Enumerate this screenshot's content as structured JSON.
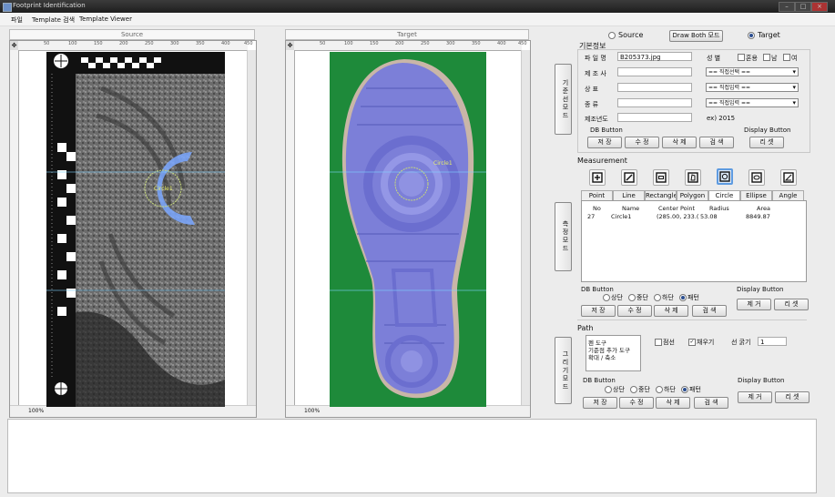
{
  "window": {
    "title": "Footprint Identification"
  },
  "menu": [
    "파일",
    "Template 검색",
    "Template Viewer"
  ],
  "source_panel": {
    "header": "Source",
    "zoom": "100%",
    "canvas_label": "Circle1"
  },
  "target_panel": {
    "header": "Target",
    "zoom": "100%",
    "canvas_label": "Circle1"
  },
  "ruler_ticks": [
    "50",
    "100",
    "150",
    "200",
    "250",
    "300",
    "350",
    "400",
    "450"
  ],
  "mode": {
    "source_label": "Source",
    "draw_both_label": "Draw Both 모드",
    "target_label": "Target",
    "selected": "Target"
  },
  "basic_info": {
    "title": "기본정보",
    "mode_button": "기준선모드",
    "filename_label": "파 일 명",
    "filename_value": "B205373.jpg",
    "maker_label": "제 조 사",
    "label_label": "상 표",
    "type_label": "종 류",
    "year_label": "제조년도",
    "year_hint": "ex) 2015",
    "gender_label": "성 별",
    "gender_options": [
      "혼용",
      "남",
      "여"
    ],
    "select1": "== 직접선택 ==",
    "select2": "== 직접입력 ==",
    "select3": "== 직접입력 =="
  },
  "db_button1": {
    "title": "DB Button",
    "save": "저 장",
    "edit": "수 정",
    "delete": "삭 제",
    "search": "검 색"
  },
  "display_button1": {
    "title": "Display Button",
    "reset": "리 셋"
  },
  "measurement": {
    "title": "Measurement",
    "mode_button": "측정모드",
    "tabs": [
      "Point",
      "Line",
      "Rectangle",
      "Polygon",
      "Circle",
      "Ellipse",
      "Angle"
    ],
    "tools": [
      "point-tool-icon",
      "line-tool-icon",
      "rectangle-tool-icon",
      "polygon-tool-icon",
      "circle-tool-icon",
      "ellipse-tool-icon",
      "angle-tool-icon"
    ],
    "active_tab": "Circle",
    "columns": [
      "No",
      "Name",
      "Center Point",
      "Radius",
      "Area"
    ],
    "rows": [
      {
        "no": "27",
        "name": "Circle1",
        "center": "(285.00, 233.(",
        "radius": "53.08",
        "area": "8849.87"
      }
    ],
    "db_title": "DB Button",
    "radios": [
      "상단",
      "중단",
      "하단",
      "패턴"
    ],
    "radio_selected": "패턴",
    "save": "저 장",
    "edit": "수 정",
    "delete": "삭 제",
    "search": "검 색",
    "display_title": "Display Button",
    "view": "제 거",
    "reset": "리 셋"
  },
  "path": {
    "title": "Path",
    "mode_button": "그리기모드",
    "tools": [
      "펜 도구",
      "기준점 추가 도구",
      "확대 / 축소"
    ],
    "dotted_label": "점선",
    "fill_label": "채우기",
    "fill_checked": true,
    "width_label": "선 굵기",
    "width_value": "1",
    "db_title": "DB Button",
    "radios": [
      "상단",
      "중단",
      "하단",
      "패턴"
    ],
    "radio_selected": "패턴",
    "save": "저 장",
    "edit": "수 정",
    "delete": "삭 제",
    "search": "검 색",
    "display_title": "Display Button",
    "view": "제 거",
    "reset": "리 셋"
  },
  "colors": {
    "accent": "#5e9be0",
    "shoe_fill": "#7c7fd8",
    "target_bg": "#1e8a3a",
    "overlay": "#7aa7ff"
  }
}
